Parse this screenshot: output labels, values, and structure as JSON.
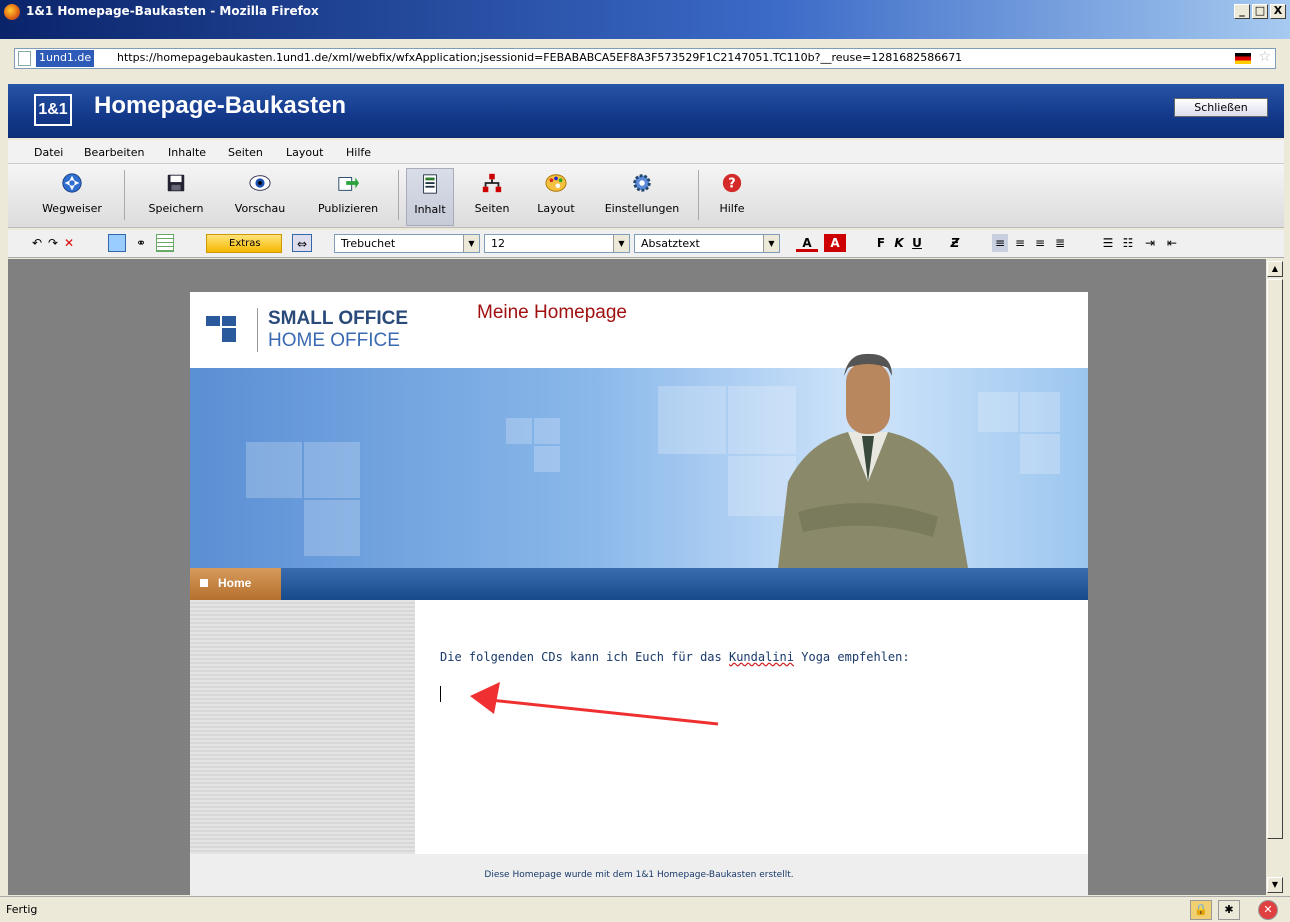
{
  "window": {
    "title": "1&1 Homepage-Baukasten - Mozilla Firefox",
    "min": "_",
    "max": "□",
    "close": "X"
  },
  "address": {
    "site": "1und1.de",
    "url": "https://homepagebaukasten.1und1.de/xml/webfix/wfxApplication;jsessionid=FEBABABCA5EF8A3F573529F1C2147051.TC110b?__reuse=1281682586671"
  },
  "app": {
    "logo": "1&1",
    "title": "Homepage-Baukasten",
    "close_label": "Schließen"
  },
  "menu": [
    "Datei",
    "Bearbeiten",
    "Inhalte",
    "Seiten",
    "Layout",
    "Hilfe"
  ],
  "toolbar": [
    {
      "label": "Wegweiser",
      "icon": "navigator-icon"
    },
    {
      "label": "Speichern",
      "icon": "save-icon"
    },
    {
      "label": "Vorschau",
      "icon": "preview-eye-icon"
    },
    {
      "label": "Publizieren",
      "icon": "publish-icon"
    },
    {
      "label": "Inhalt",
      "icon": "content-icon",
      "active": true
    },
    {
      "label": "Seiten",
      "icon": "sitemap-icon"
    },
    {
      "label": "Layout",
      "icon": "palette-icon"
    },
    {
      "label": "Einstellungen",
      "icon": "settings-gear-icon"
    },
    {
      "label": "Hilfe",
      "icon": "help-icon"
    }
  ],
  "format": {
    "extras": "Extras",
    "font": "Trebuchet",
    "size": "12",
    "style": "Absatztext",
    "bold": "F",
    "italic": "K",
    "underline": "U"
  },
  "site": {
    "brand_line1": "SMALL OFFICE",
    "brand_line2": "HOME OFFICE",
    "title": "Meine Homepage",
    "nav_home": "Home",
    "text_before": "Die folgenden CDs kann ich Euch für das ",
    "text_misspelled": "Kundalini",
    "text_after": " Yoga empfehlen:",
    "footer": "Diese Homepage wurde mit dem 1&1 Homepage-Baukasten erstellt."
  },
  "status": {
    "text": "Fertig"
  },
  "colors": {
    "annotation_arrow": "#f03030",
    "app_header": "#13388a"
  }
}
